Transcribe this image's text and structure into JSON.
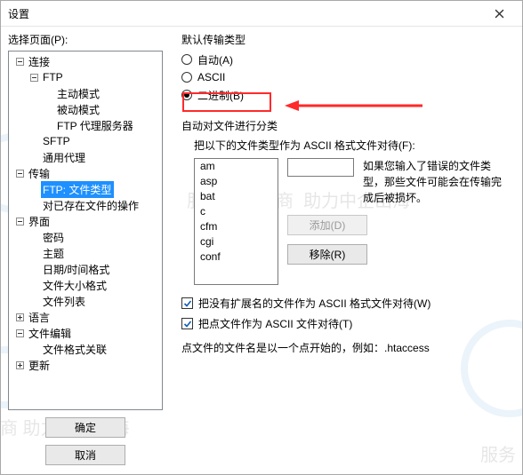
{
  "title": "设置",
  "left": {
    "label": "选择页面(P):",
    "tree": [
      {
        "level": 1,
        "expander": "minus",
        "label": "连接",
        "name": "tree-connection"
      },
      {
        "level": 2,
        "expander": "minus",
        "label": "FTP",
        "name": "tree-ftp"
      },
      {
        "level": 3,
        "expander": "",
        "label": "主动模式",
        "name": "tree-active"
      },
      {
        "level": 3,
        "expander": "",
        "label": "被动模式",
        "name": "tree-passive"
      },
      {
        "level": 3,
        "expander": "",
        "label": "FTP 代理服务器",
        "name": "tree-ftp-proxy"
      },
      {
        "level": 2,
        "expander": "",
        "label": "SFTP",
        "name": "tree-sftp"
      },
      {
        "level": 2,
        "expander": "",
        "label": "通用代理",
        "name": "tree-generic-proxy"
      },
      {
        "level": 1,
        "expander": "minus",
        "label": "传输",
        "name": "tree-transfer"
      },
      {
        "level": 2,
        "expander": "",
        "label": "FTP: 文件类型",
        "name": "tree-ftp-filetype",
        "selected": true
      },
      {
        "level": 2,
        "expander": "",
        "label": "对已存在文件的操作",
        "name": "tree-existing-file"
      },
      {
        "level": 1,
        "expander": "minus",
        "label": "界面",
        "name": "tree-interface"
      },
      {
        "level": 2,
        "expander": "",
        "label": "密码",
        "name": "tree-password"
      },
      {
        "level": 2,
        "expander": "",
        "label": "主题",
        "name": "tree-theme"
      },
      {
        "level": 2,
        "expander": "",
        "label": "日期/时间格式",
        "name": "tree-datetime"
      },
      {
        "level": 2,
        "expander": "",
        "label": "文件大小格式",
        "name": "tree-filesize"
      },
      {
        "level": 2,
        "expander": "",
        "label": "文件列表",
        "name": "tree-filelist"
      },
      {
        "level": 1,
        "expander": "plus",
        "label": "语言",
        "name": "tree-language"
      },
      {
        "level": 1,
        "expander": "minus",
        "label": "文件编辑",
        "name": "tree-file-edit"
      },
      {
        "level": 2,
        "expander": "",
        "label": "文件格式关联",
        "name": "tree-file-assoc"
      },
      {
        "level": 1,
        "expander": "plus",
        "label": "更新",
        "name": "tree-update"
      }
    ],
    "ok": "确定",
    "cancel": "取消"
  },
  "right": {
    "group": "默认传输类型",
    "radios": [
      {
        "label": "自动(A)",
        "name": "radio-auto",
        "checked": false
      },
      {
        "label": "ASCII",
        "name": "radio-ascii",
        "checked": false
      },
      {
        "label": "二进制(B)",
        "name": "radio-binary",
        "checked": true
      }
    ],
    "auto_label": "自动对文件进行分类",
    "ascii_hint": "把以下的文件类型作为 ASCII 格式文件对待(F):",
    "list": [
      "am",
      "asp",
      "bat",
      "c",
      "cfm",
      "cgi",
      "conf"
    ],
    "warn": "如果您输入了错误的文件类型，那些文件可能会在传输完成后被损坏。",
    "add_btn": "添加(D)",
    "remove_btn": "移除(R)",
    "cb1": "把没有扩展名的文件作为 ASCII 格式文件对待(W)",
    "cb2": "把点文件作为 ASCII 文件对待(T)",
    "note": "点文件的文件名是以一个点开始的，例如：.htaccess"
  }
}
